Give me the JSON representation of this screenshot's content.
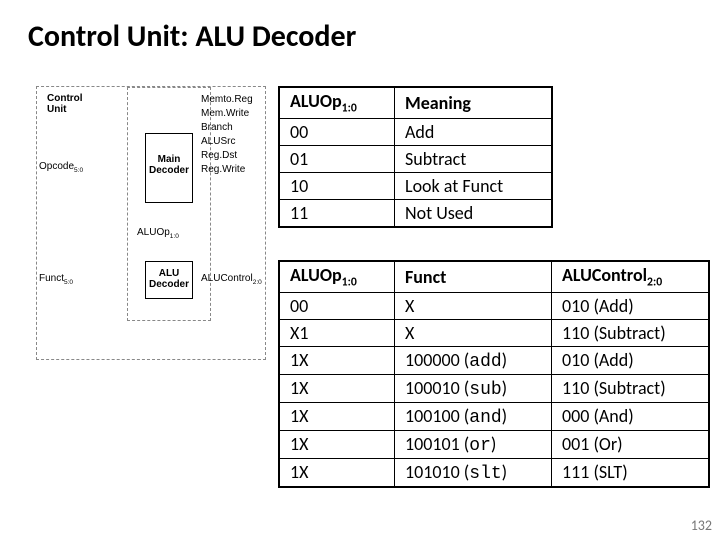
{
  "title": "Control Unit: ALU Decoder",
  "diagram": {
    "control_unit": "Control\nUnit",
    "main_decoder": "Main\nDecoder",
    "alu_decoder": "ALU\nDecoder",
    "opcode": "Opcode",
    "opcode_bits": "5:0",
    "funct": "Funct",
    "funct_bits": "5:0",
    "aluop": "ALUOp",
    "aluop_bits": "1:0",
    "aluctrl": "ALUControl",
    "aluctrl_bits": "2:0",
    "signals": [
      "Memto.Reg",
      "Mem.Write",
      "Branch",
      "ALUSrc",
      "Reg.Dst",
      "Reg.Write"
    ]
  },
  "table1": {
    "h1a": "ALUOp",
    "h1b": "1:0",
    "h2": "Meaning",
    "rows": [
      {
        "a": "00",
        "b": "Add"
      },
      {
        "a": "01",
        "b": "Subtract"
      },
      {
        "a": "10",
        "b": "Look at Funct"
      },
      {
        "a": "11",
        "b": "Not Used"
      }
    ]
  },
  "table2": {
    "h1a": "ALUOp",
    "h1b": "1:0",
    "h2": "Funct",
    "h3a": "ALUControl",
    "h3b": "2:0",
    "rows": [
      {
        "a": "00",
        "b": "X",
        "c": "010 (Add)",
        "mono": ""
      },
      {
        "a": "X1",
        "b": "X",
        "c": "110 (Subtract)",
        "mono": ""
      },
      {
        "a": "1X",
        "b": "100000 (",
        "mono": "add",
        "b2": ")",
        "c": "010 (Add)"
      },
      {
        "a": "1X",
        "b": "100010 (",
        "mono": "sub",
        "b2": ")",
        "c": "110 (Subtract)"
      },
      {
        "a": "1X",
        "b": "100100 (",
        "mono": "and",
        "b2": ")",
        "c": "000 (And)"
      },
      {
        "a": "1X",
        "b": "100101 (",
        "mono": "or",
        "b2": ")",
        "c": "001 (Or)"
      },
      {
        "a": "1X",
        "b": "101010 (",
        "mono": "slt",
        "b2": ")",
        "c": "111 (SLT)"
      }
    ]
  },
  "page": "132"
}
